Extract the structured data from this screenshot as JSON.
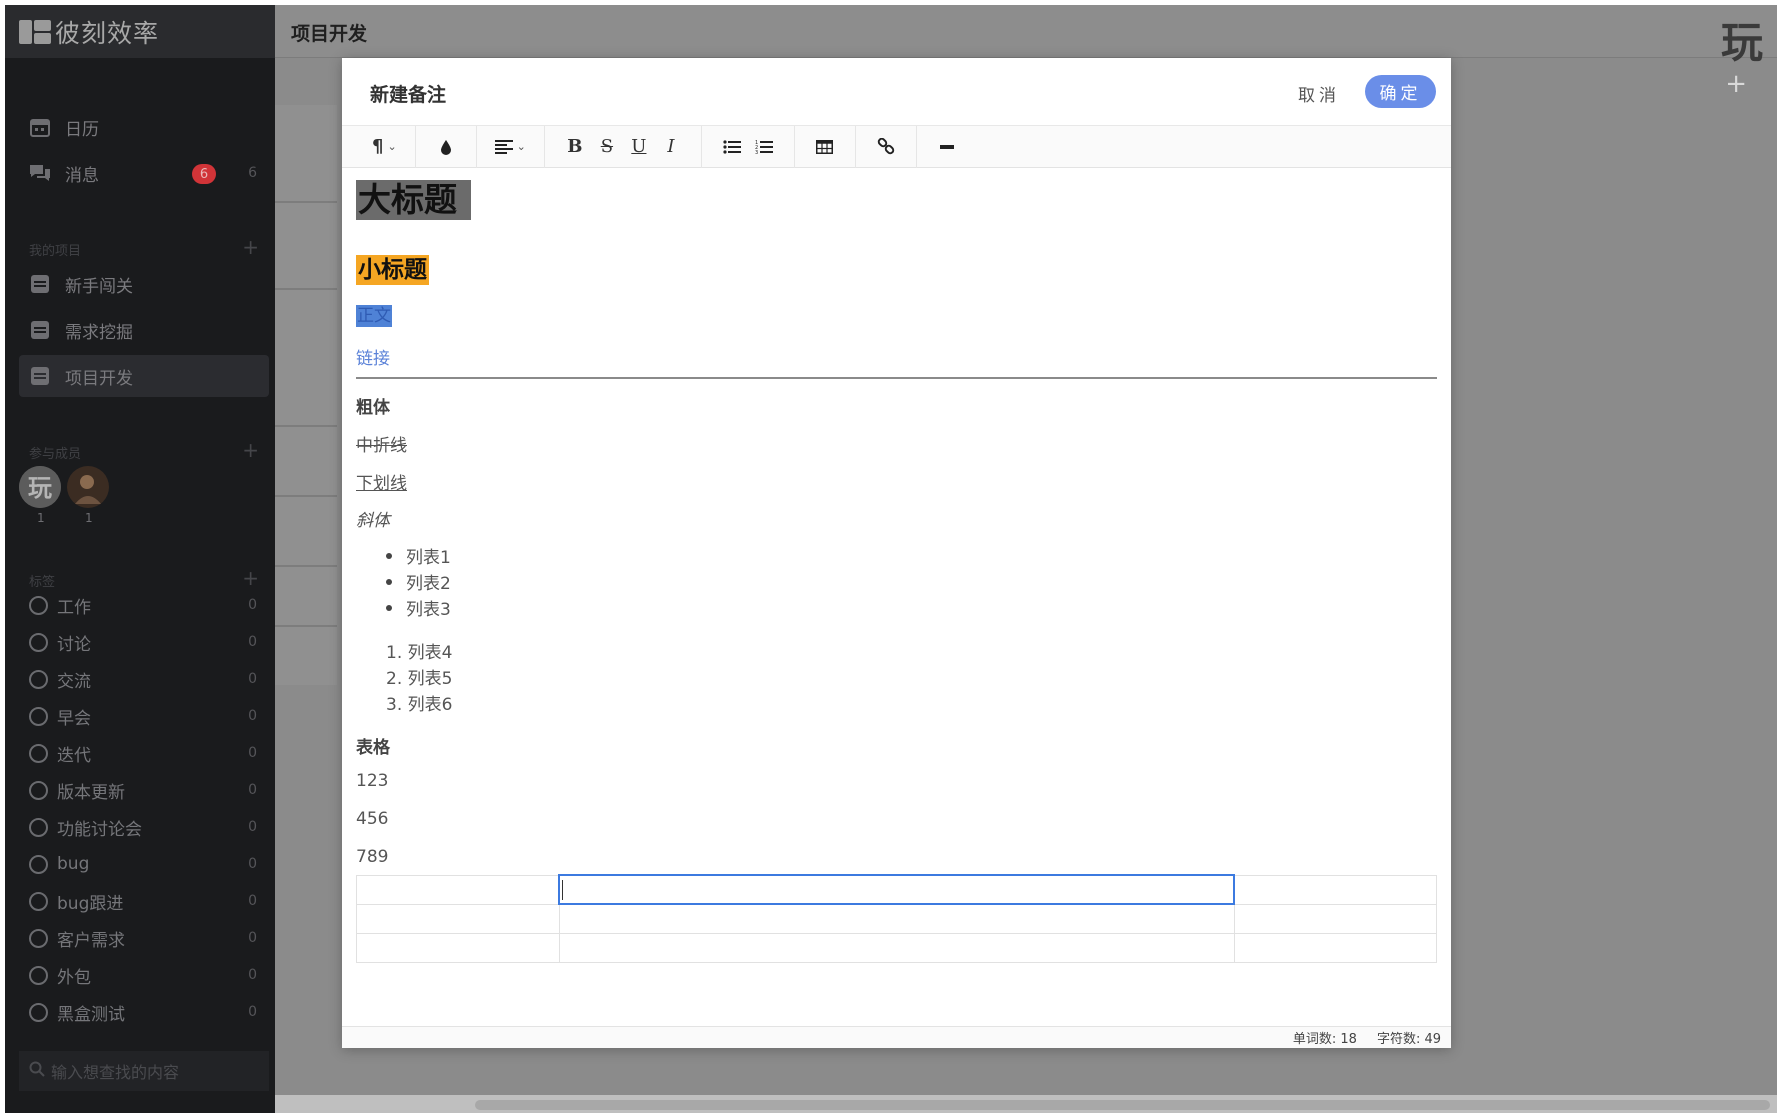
{
  "app": {
    "logo_text": "彼刻效率",
    "brand_glyph": "玩"
  },
  "sidebar": {
    "nav": [
      {
        "label": "日历",
        "icon": "calendar-icon"
      },
      {
        "label": "消息",
        "icon": "chat-icon",
        "badge": "6",
        "count": "6"
      }
    ],
    "projects_header": "我的项目",
    "projects": [
      {
        "label": "新手闯关"
      },
      {
        "label": "需求挖掘"
      },
      {
        "label": "项目开发",
        "active": true
      }
    ],
    "members_header": "参与成员",
    "members": [
      {
        "count": "1"
      },
      {
        "count": "1"
      }
    ],
    "tags_header": "标签",
    "tags": [
      {
        "label": "工作",
        "count": "0"
      },
      {
        "label": "讨论",
        "count": "0"
      },
      {
        "label": "交流",
        "count": "0"
      },
      {
        "label": "早会",
        "count": "0"
      },
      {
        "label": "迭代",
        "count": "0"
      },
      {
        "label": "版本更新",
        "count": "0"
      },
      {
        "label": "功能讨论会",
        "count": "0"
      },
      {
        "label": "bug",
        "count": "0"
      },
      {
        "label": "bug跟进",
        "count": "0"
      },
      {
        "label": "客户需求",
        "count": "0"
      },
      {
        "label": "外包",
        "count": "0"
      },
      {
        "label": "黑盒测试",
        "count": "0"
      }
    ],
    "search_placeholder": "输入想查找的内容"
  },
  "header": {
    "title": "项目开发"
  },
  "modal": {
    "title": "新建备注",
    "cancel_label": "取消",
    "ok_label": "确定",
    "toolbar": {
      "paragraph": "¶",
      "bold": "B",
      "strike": "S",
      "underline": "U",
      "italic": "I"
    },
    "content": {
      "h1": "大标题",
      "h2": "小标题",
      "para": "正文",
      "link": "链接",
      "bold": "粗体",
      "strike": "中折线",
      "underline": "下划线",
      "italic": "斜体",
      "bullets": [
        "列表1",
        "列表2",
        "列表3"
      ],
      "ordered": [
        "1. 列表4",
        "2. 列表5",
        "3. 列表6"
      ],
      "table_title": "表格",
      "numbers": [
        "123",
        "456",
        "789"
      ]
    },
    "status": {
      "words": "单词数: 18",
      "chars": "字符数: 49"
    }
  },
  "colors": {
    "accent": "#6a8ee8",
    "badge": "#d13438",
    "h2_highlight": "#f5a623",
    "link": "#5b82d8"
  }
}
